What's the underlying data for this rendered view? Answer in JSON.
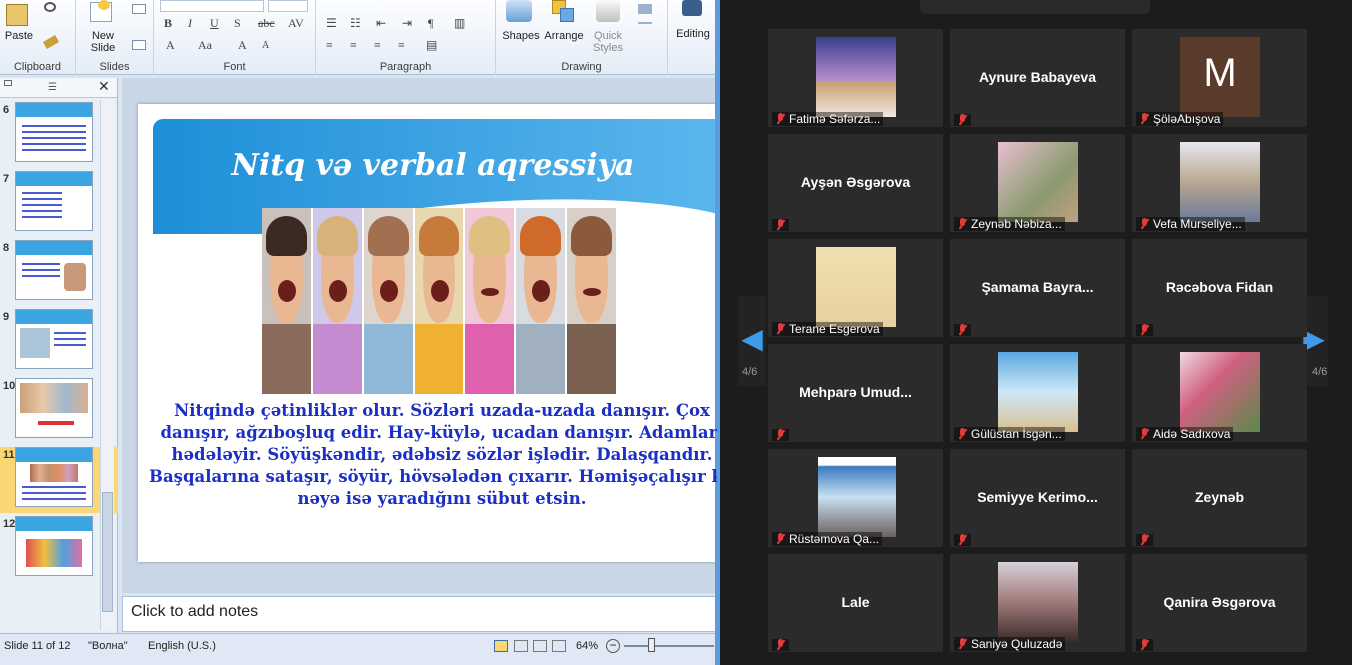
{
  "ribbon": {
    "paste_label": "Paste",
    "new_slide_label": "New Slide",
    "shapes_label": "Shapes",
    "arrange_label": "Arrange",
    "quick_styles_label": "Quick Styles",
    "editing_label": "Editing",
    "groups": [
      "Clipboard",
      "Slides",
      "Font",
      "Paragraph",
      "Drawing"
    ]
  },
  "thumbnails": [
    {
      "num": "6"
    },
    {
      "num": "7"
    },
    {
      "num": "8"
    },
    {
      "num": "9"
    },
    {
      "num": "10"
    },
    {
      "num": "11"
    },
    {
      "num": "12"
    }
  ],
  "slide": {
    "title": "Nitq və verbal aqressiya",
    "body": "Nitqində çətinliklər olur. Sözləri uzada-uzada danışır.  Çox danışır, ağzıboşluq  edir. Hay-küylə, ucadan danışır. Adamları hədələyir. Söyüşkəndir,  ədəbsiz sözlər işlədir. Dalaşqandır. Başqalarına sataşır, söyür, hövsələdən çıxarır. Həmişəçalışır ki, nəyə isə yaradığını sübut etsin."
  },
  "notes": {
    "placeholder": "Click to add notes"
  },
  "status": {
    "slide": "Slide 11 of 12",
    "theme": "\"Волна\"",
    "language": "English (U.S.)",
    "zoom": "64%"
  },
  "zoom_gallery": {
    "page_left": "4/6",
    "page_right": "4/6",
    "participants": [
      {
        "label": "Fatimə Səfərza...",
        "name": "",
        "pic": "colosseum"
      },
      {
        "label": "",
        "name": "Aynure Babayeva",
        "pic": ""
      },
      {
        "label": "ŞöləAbışova",
        "name": "",
        "pic": "avatar-m",
        "avatar_letter": "M"
      },
      {
        "label": "",
        "name": "Ayşən Əsgərova",
        "pic": ""
      },
      {
        "label": "Zeynəb Nəbiza...",
        "name": "",
        "pic": "blossom"
      },
      {
        "label": "Vefa Murseliye...",
        "name": "",
        "pic": "family"
      },
      {
        "label": "Terane Esgerova",
        "name": "",
        "pic": "poster"
      },
      {
        "label": "",
        "name": "Şamama  Bayra...",
        "pic": ""
      },
      {
        "label": "",
        "name": "Rəcəbova Fidan",
        "pic": ""
      },
      {
        "label": "",
        "name": "Mehparə  Umud...",
        "pic": ""
      },
      {
        "label": "Gülüstan İsgən...",
        "name": "",
        "pic": "flowers-sky"
      },
      {
        "label": "Aidə Sadıxova",
        "name": "",
        "pic": "roses"
      },
      {
        "label": "Rüstəmova Qa...",
        "name": "",
        "pic": "mountain"
      },
      {
        "label": "",
        "name": "Semiyye  Kerimo...",
        "pic": ""
      },
      {
        "label": "",
        "name": "Zeynəb",
        "pic": ""
      },
      {
        "label": "",
        "name": "Lale",
        "pic": ""
      },
      {
        "label": "Saniyə Quluzadə",
        "name": "",
        "pic": "portrait"
      },
      {
        "label": "",
        "name": "Qanira Əsgərova",
        "pic": ""
      }
    ]
  },
  "colors": {
    "slide_title_band": "#1d8fd8",
    "slide_text": "#1b2fc6",
    "zoom_bg": "#1c1c1c",
    "tile_bg": "#2b2b2b",
    "arrow": "#3d9be9",
    "muted_mic": "#e23b3b"
  }
}
